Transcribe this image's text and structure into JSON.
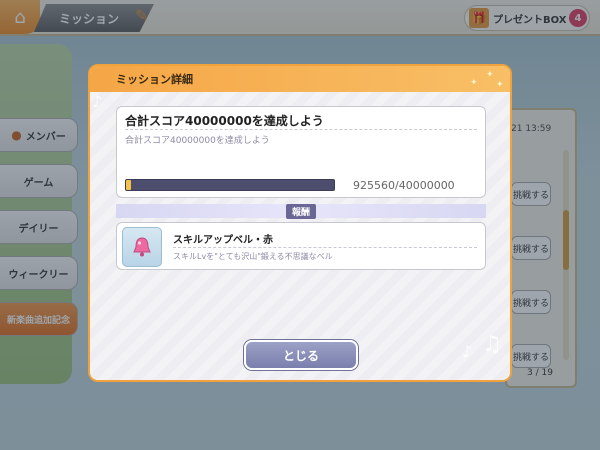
{
  "header": {
    "title": "ミッション",
    "present_box_label": "プレゼントBOX",
    "present_count": "4"
  },
  "sidebar": {
    "items": [
      {
        "label": "メンバー"
      },
      {
        "label": "ゲーム"
      },
      {
        "label": "デイリー"
      },
      {
        "label": "ウィークリー"
      },
      {
        "label": "新楽曲追加記念"
      }
    ]
  },
  "list_panel": {
    "timestamp": "21 13:59",
    "button_label": "挑戦する",
    "page_indicator": "3 / 19"
  },
  "modal": {
    "title": "ミッション詳細",
    "mission": {
      "title": "合計スコア40000000を達成しよう",
      "description": "合計スコア40000000を達成しよう",
      "progress_text": "925560/40000000",
      "progress_fraction": 0.023
    },
    "reward_label": "報酬",
    "reward": {
      "name": "スキルアップベル・赤",
      "description": "スキルLvを\"とても沢山\"鍛える不思議なベル"
    },
    "close_label": "とじる"
  },
  "colors": {
    "modal_accent": "#f0a23c",
    "progress_fill": "#f2c24b",
    "close_button": "#8a8fba"
  }
}
